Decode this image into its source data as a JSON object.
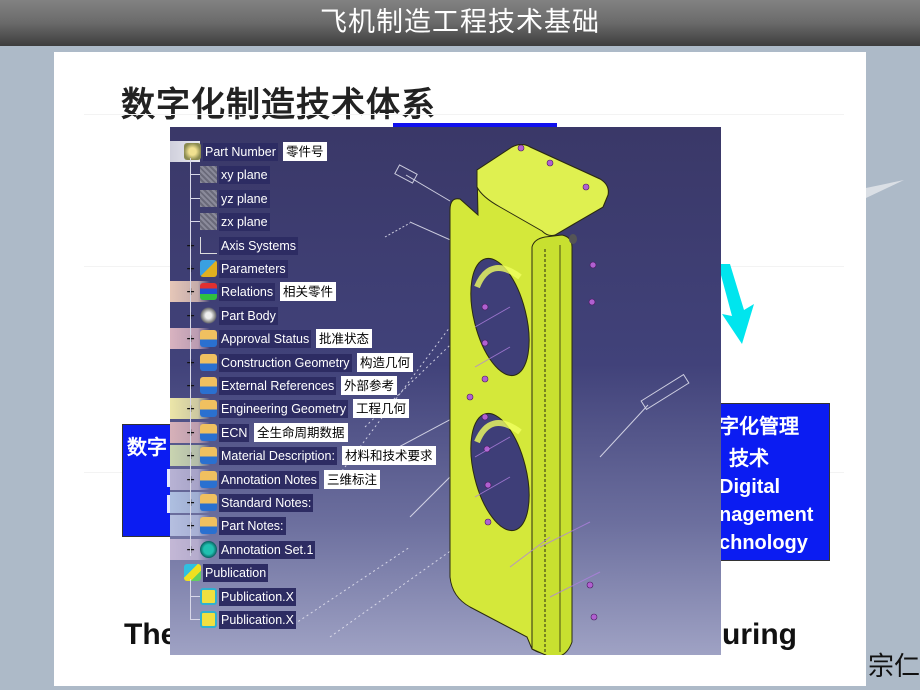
{
  "header": {
    "title": "飞机制造工程技术基础"
  },
  "slide": {
    "heading": "数字化制造技术体系",
    "left_box": {
      "text": "数字"
    },
    "right_box": {
      "lines": [
        "字化管理",
        "技术",
        "Digital",
        "nagement",
        "chnology"
      ]
    },
    "bottom_text_left": "The",
    "bottom_text_right": "uring",
    "author_fragment": "宗仁",
    "colors": {
      "blue_box": "#0b1cf2",
      "arrow": "#00e5ee",
      "title_bar": "#5a5a5a"
    }
  },
  "cad": {
    "tree": [
      {
        "label": "Part Number",
        "annotation": "零件号",
        "icon": "part-number-icon",
        "level": 0,
        "expander": "none"
      },
      {
        "label": "xy plane",
        "icon": "plane-icon",
        "level": 1,
        "expander": "none"
      },
      {
        "label": "yz plane",
        "icon": "plane-icon",
        "level": 1,
        "expander": "none"
      },
      {
        "label": "zx plane",
        "icon": "plane-icon",
        "level": 1,
        "expander": "none"
      },
      {
        "label": "Axis Systems",
        "icon": "axis-systems-icon",
        "level": 1,
        "expander": "plus"
      },
      {
        "label": "Parameters",
        "icon": "parameters-icon",
        "level": 1,
        "expander": "plus"
      },
      {
        "label": "Relations",
        "annotation": "相关零件",
        "icon": "relations-icon",
        "level": 1,
        "expander": "plus",
        "band": "#e6c7b8"
      },
      {
        "label": "Part Body",
        "icon": "part-body-icon",
        "level": 1,
        "expander": "plus"
      },
      {
        "label": "Approval Status",
        "annotation": "批准状态",
        "icon": "geometric-set-icon",
        "level": 1,
        "expander": "plus",
        "band": "#d9b3c0"
      },
      {
        "label": "Construction Geometry",
        "annotation": "构造几何",
        "icon": "geometric-set-icon",
        "level": 1,
        "expander": "plus"
      },
      {
        "label": "External References",
        "annotation": "外部参考",
        "icon": "geometric-set-icon",
        "level": 1,
        "expander": "plus"
      },
      {
        "label": "Engineering Geometry",
        "annotation": "工程几何",
        "icon": "geometric-set-icon",
        "level": 1,
        "expander": "plus",
        "band": "#ece6a8"
      },
      {
        "label": "ECN",
        "annotation": "全生命周期数据",
        "icon": "geometric-set-icon",
        "level": 1,
        "expander": "plus",
        "band": "#d7b1b8"
      },
      {
        "label": "Material Description:",
        "annotation": "材料和技术要求",
        "icon": "geometric-set-icon",
        "level": 1,
        "expander": "plus",
        "band": "#c9d4b0"
      },
      {
        "label": "Annotation Notes",
        "annotation": "三维标注",
        "icon": "geometric-set-icon",
        "level": 1,
        "expander": "plus",
        "band": "#b8b3d4"
      },
      {
        "label": "Standard Notes:",
        "icon": "geometric-set-icon",
        "level": 1,
        "expander": "plus",
        "band": "#aebfe0"
      },
      {
        "label": "Part Notes:",
        "icon": "geometric-set-icon",
        "level": 1,
        "expander": "plus",
        "band": "#b5bfe0"
      },
      {
        "label": "Annotation Set.1",
        "icon": "annotation-set-icon",
        "level": 1,
        "expander": "plus",
        "band": "#c4b8d6"
      },
      {
        "label": "Publication",
        "icon": "publication-icon",
        "level": 0,
        "expander": "none"
      },
      {
        "label": "Publication.X",
        "icon": "publication-item-icon",
        "level": 1,
        "expander": "none"
      },
      {
        "label": "Publication.X",
        "icon": "publication-item-icon",
        "level": 1,
        "expander": "none"
      }
    ],
    "part_color": "#d8ec3a"
  }
}
